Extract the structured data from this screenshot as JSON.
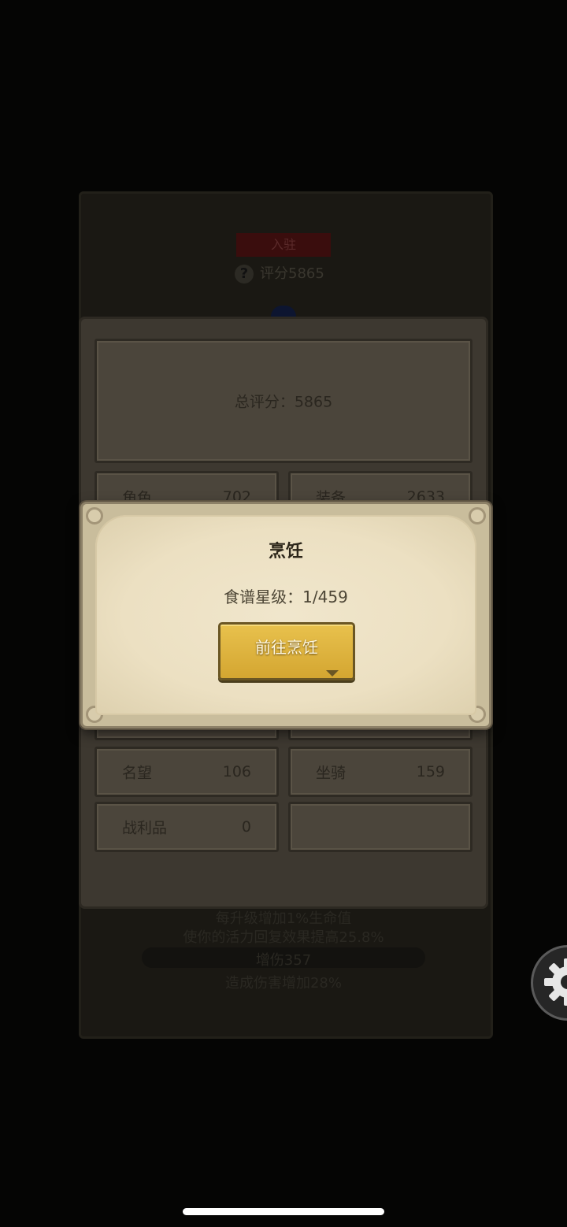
{
  "background": {
    "tag_label": "入驻",
    "score_label": "评分5865",
    "line1": "每升级增加1%生命值",
    "line2": "使你的活力回复效果提高25.8%",
    "line3": "增伤357",
    "line4": "造成伤害增加28%"
  },
  "score_panel": {
    "total_label": "总评分：5865",
    "items": [
      {
        "label": "角色",
        "value": "702"
      },
      {
        "label": "装备",
        "value": "2633"
      },
      {
        "label": "名望",
        "value": "106"
      },
      {
        "label": "坐骑",
        "value": "159"
      },
      {
        "label": "战利品",
        "value": "0"
      }
    ]
  },
  "dialog": {
    "title": "烹饪",
    "recipe_stars": "食谱星级：1/459",
    "go_button_label": "前往烹饪"
  },
  "icons": {
    "settings": "gear-icon",
    "help": "question-icon"
  },
  "colors": {
    "button_gold": "#e0b43f",
    "parchment": "#ece0c2",
    "panel": "#3d3830"
  }
}
